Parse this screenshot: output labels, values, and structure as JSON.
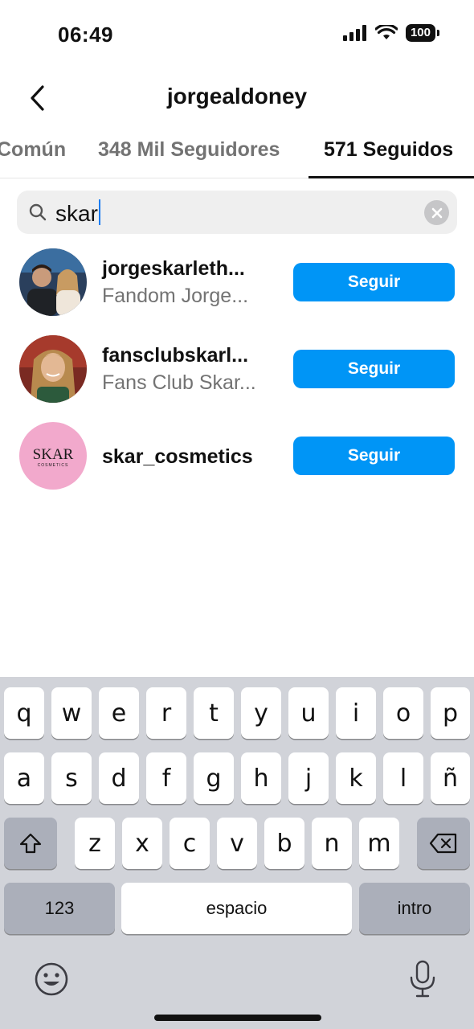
{
  "status_bar": {
    "time": "06:49",
    "battery": "100"
  },
  "header": {
    "title": "jorgealdoney"
  },
  "tabs": [
    {
      "label": "Común"
    },
    {
      "label": "348 Mil Seguidores"
    },
    {
      "label": "571 Seguidos"
    }
  ],
  "search": {
    "value": "skar"
  },
  "results": [
    {
      "username": "jorgeskarleth...",
      "fullname": "Fandom Jorge...",
      "button": "Seguir"
    },
    {
      "username": "fansclubskarl...",
      "fullname": "Fans Club Skar...",
      "button": "Seguir"
    },
    {
      "username": "skar_cosmetics",
      "fullname": "",
      "button": "Seguir",
      "logo_text": "SKAR",
      "logo_sub": "COSMETICS"
    }
  ],
  "keyboard": {
    "row1": [
      "q",
      "w",
      "e",
      "r",
      "t",
      "y",
      "u",
      "i",
      "o",
      "p"
    ],
    "row2": [
      "a",
      "s",
      "d",
      "f",
      "g",
      "h",
      "j",
      "k",
      "l",
      "ñ"
    ],
    "row3": [
      "z",
      "x",
      "c",
      "v",
      "b",
      "n",
      "m"
    ],
    "numbers_label": "123",
    "space_label": "espacio",
    "return_label": "intro"
  },
  "colors": {
    "accent": "#0095f6",
    "keyboard_bg": "#d1d3d9"
  }
}
